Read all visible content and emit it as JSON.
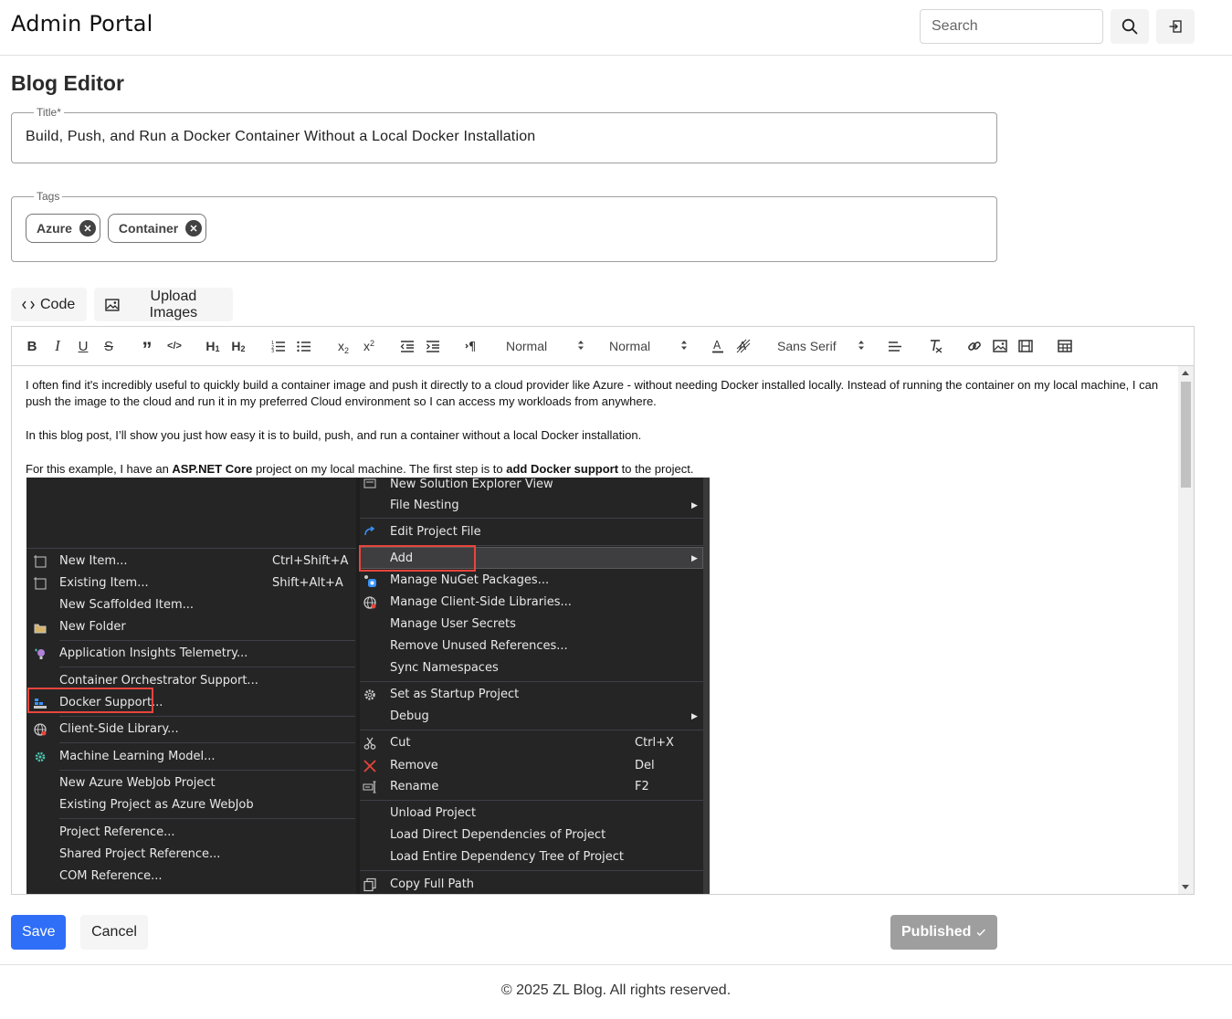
{
  "header": {
    "brand": "Admin Portal",
    "search_placeholder": "Search",
    "search_icon": "search-icon",
    "logout_icon": "logout-icon"
  },
  "page": {
    "title": "Blog Editor"
  },
  "form": {
    "title_label": "Title*",
    "title_value": "Build, Push, and Run a Docker Container Without a Local Docker Installation",
    "tags_label": "Tags",
    "tags": [
      "Azure",
      "Container"
    ]
  },
  "tabs": {
    "code_label": "Code",
    "upload_label": "Upload Images"
  },
  "toolbar": {
    "bold": "B",
    "italic": "I",
    "underline": "U",
    "strike": "S",
    "quote": "”",
    "code": "</>",
    "h1": "H1",
    "h2": "H2",
    "size_value": "Normal",
    "header_value": "Normal",
    "font_value": "Sans Serif"
  },
  "content": {
    "para1": "I often find it's incredibly useful to quickly build a container image and push it directly to a cloud provider like Azure - without needing Docker installed locally. Instead of running the container on my local machine, I can push the image to the cloud and run it in my preferred Cloud environment so I can access my workloads from anywhere.",
    "para2": "In this blog post, I’ll show you just how easy it is to build, push, and run a container without a local Docker installation.",
    "para3_a": "For this example, I have an ",
    "para3_b": "ASP.NET Core",
    "para3_c": " project on my local machine. The first step is to ",
    "para3_d": "add Docker support",
    "para3_e": " to the project."
  },
  "screenshot": {
    "left_menu": [
      {
        "label": "New Item...",
        "shortcut": "Ctrl+Shift+A"
      },
      {
        "label": "Existing Item...",
        "shortcut": "Shift+Alt+A"
      },
      {
        "label": "New Scaffolded Item...",
        "shortcut": ""
      },
      {
        "label": "New Folder",
        "shortcut": ""
      },
      {
        "label": "Application Insights Telemetry...",
        "shortcut": ""
      },
      {
        "label": "Container Orchestrator Support...",
        "shortcut": ""
      },
      {
        "label": "Docker Support...",
        "shortcut": ""
      },
      {
        "label": "Client-Side Library...",
        "shortcut": ""
      },
      {
        "label": "Machine Learning Model...",
        "shortcut": ""
      },
      {
        "label": "New Azure WebJob Project",
        "shortcut": ""
      },
      {
        "label": "Existing Project as Azure WebJob",
        "shortcut": ""
      },
      {
        "label": "Project Reference...",
        "shortcut": ""
      },
      {
        "label": "Shared Project Reference...",
        "shortcut": ""
      },
      {
        "label": "COM Reference...",
        "shortcut": ""
      }
    ],
    "right_menu": [
      {
        "label": "New Solution Explorer View",
        "shortcut": ""
      },
      {
        "label": "File Nesting",
        "shortcut": ""
      },
      {
        "label": "Edit Project File",
        "shortcut": ""
      },
      {
        "label": "Add",
        "shortcut": ""
      },
      {
        "label": "Manage NuGet Packages...",
        "shortcut": ""
      },
      {
        "label": "Manage Client-Side Libraries...",
        "shortcut": ""
      },
      {
        "label": "Manage User Secrets",
        "shortcut": ""
      },
      {
        "label": "Remove Unused References...",
        "shortcut": ""
      },
      {
        "label": "Sync Namespaces",
        "shortcut": ""
      },
      {
        "label": "Set as Startup Project",
        "shortcut": ""
      },
      {
        "label": "Debug",
        "shortcut": ""
      },
      {
        "label": "Cut",
        "shortcut": "Ctrl+X"
      },
      {
        "label": "Remove",
        "shortcut": "Del"
      },
      {
        "label": "Rename",
        "shortcut": "F2"
      },
      {
        "label": "Unload Project",
        "shortcut": ""
      },
      {
        "label": "Load Direct Dependencies of Project",
        "shortcut": ""
      },
      {
        "label": "Load Entire Dependency Tree of Project",
        "shortcut": ""
      },
      {
        "label": "Copy Full Path",
        "shortcut": ""
      }
    ]
  },
  "actions": {
    "save_label": "Save",
    "cancel_label": "Cancel",
    "published_label": "Published"
  },
  "footer": {
    "text": "© 2025 ZL Blog. All rights reserved."
  },
  "colors": {
    "primary": "#2f6ef6",
    "published_bg": "#9e9e9e",
    "highlight_red": "#e8453c",
    "vs_menu_bg": "#252526"
  }
}
